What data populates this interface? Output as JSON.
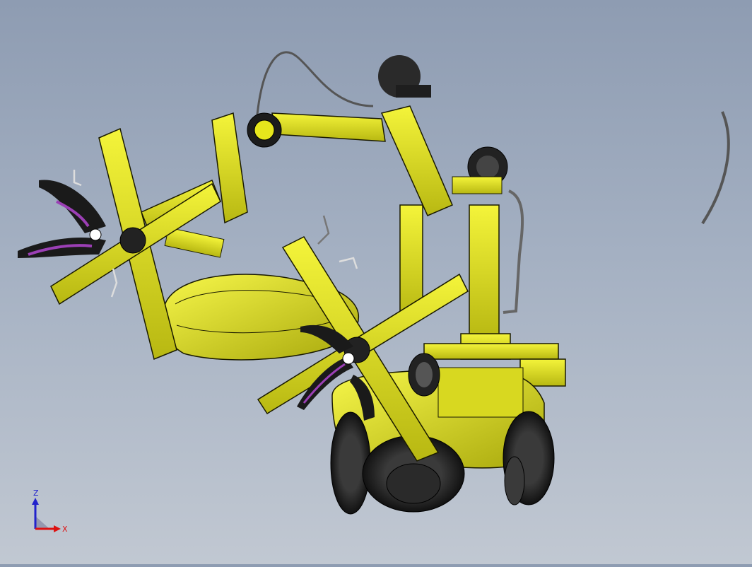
{
  "viewport": {
    "background_top": "#8e9cb2",
    "background_bottom": "#c1c8d2"
  },
  "model": {
    "body_color": "#e6e61c",
    "body_shadow": "#9a9a10",
    "outline_color": "#1a1a00",
    "tire_color": "#1c1c1c",
    "gripper_accent": "#9b3fb5",
    "cable_color": "#6b6b6b"
  },
  "triad": {
    "z_label": "Z",
    "x_label": "X",
    "z_color": "#2222cc",
    "x_color": "#dd1111",
    "icon": "coordinate-triad-icon"
  }
}
